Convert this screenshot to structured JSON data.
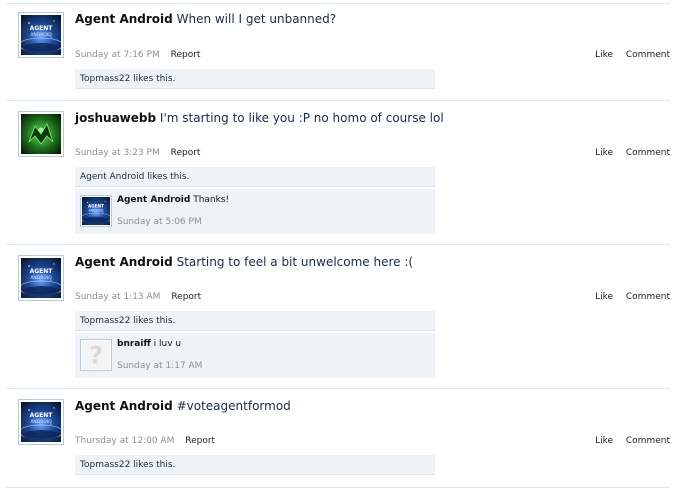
{
  "posts": [
    {
      "author": "Agent Android",
      "message": "When will I get unbanned?",
      "time": "Sunday at 7:16 PM",
      "report": "Report",
      "like": "Like",
      "comment": "Comment",
      "likes": "Topmass22 likes this.",
      "avatar_icon": "agent-android-avatar"
    },
    {
      "author": "joshuawebb",
      "message": "I'm starting to like you :P no homo of course lol",
      "time": "Sunday at 3:23 PM",
      "report": "Report",
      "like": "Like",
      "comment": "Comment",
      "likes": "Agent Android likes this.",
      "avatar_icon": "green-eagle-avatar",
      "reply": {
        "author": "Agent Android",
        "message": "Thanks!",
        "time": "Sunday at 5:06 PM"
      }
    },
    {
      "author": "Agent Android",
      "message": "Starting to feel a bit unwelcome here :(",
      "time": "Sunday at 1:13 AM",
      "report": "Report",
      "like": "Like",
      "comment": "Comment",
      "likes": "Topmass22 likes this.",
      "avatar_icon": "agent-android-avatar",
      "reply": {
        "author": "bnraiff",
        "message": "i luv u",
        "time": "Sunday at 1:17 AM"
      }
    },
    {
      "author": "Agent Android",
      "message": "#voteagentformod",
      "time": "Thursday at 12:00 AM",
      "report": "Report",
      "like": "Like",
      "comment": "Comment",
      "likes": "Topmass22 likes this.",
      "avatar_icon": "agent-android-avatar"
    }
  ],
  "colors": {
    "divider": "#dce8f2",
    "likes_background": "#eef3f8",
    "message_text": "#1b2a47",
    "meta_text": "#8b8f96"
  }
}
